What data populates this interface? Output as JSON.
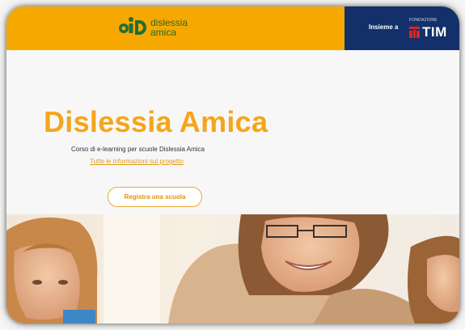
{
  "header": {
    "logo": {
      "line1": "dislessia",
      "line2": "amica",
      "mark_text": "aiD"
    },
    "partner": {
      "insieme": "Insieme a",
      "fondazione": "FONDAZIONE",
      "tim": "TIM"
    }
  },
  "hero": {
    "title": "Dislessia Amica",
    "subtitle": "Corso di e-learning per scuole Dislessia Amica",
    "info_link": "Tutte le informazioni sul progetto",
    "register_button": "Registra una scuola"
  },
  "colors": {
    "header_bg": "#f7a800",
    "tim_bg": "#13306b",
    "title": "#f5a51b",
    "logo_green": "#1f6e35"
  },
  "photo": {
    "description_icon": "teacher-students-photo"
  }
}
